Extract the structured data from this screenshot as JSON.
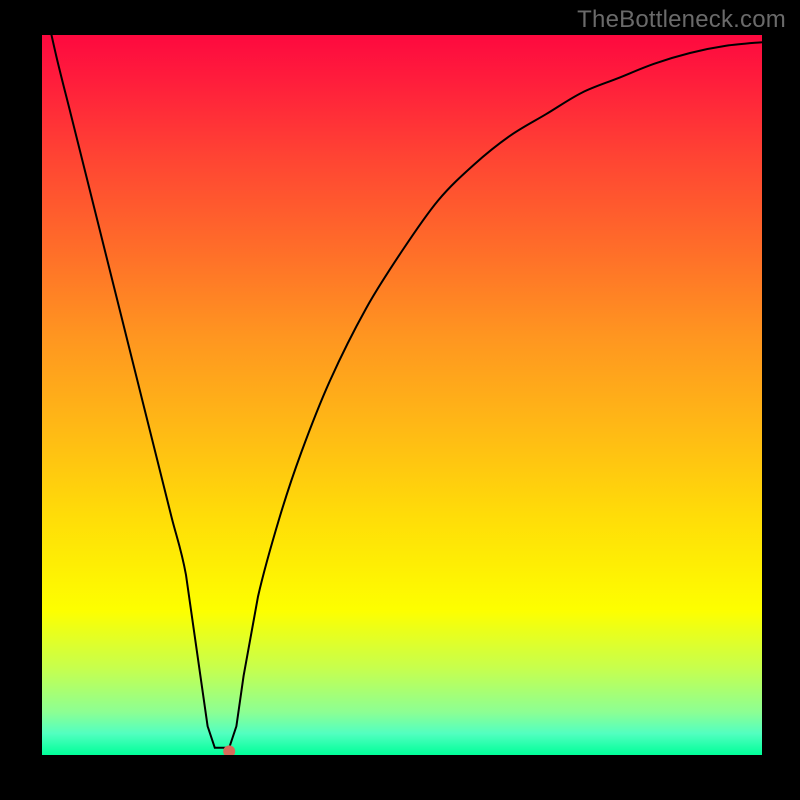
{
  "watermark": "TheBottleneck.com",
  "chart_data": {
    "type": "line",
    "title": "",
    "xlabel": "",
    "ylabel": "",
    "xlim": [
      0,
      100
    ],
    "ylim": [
      0,
      100
    ],
    "grid": false,
    "legend": false,
    "x": [
      0,
      2,
      4,
      6,
      8,
      10,
      12,
      14,
      16,
      18,
      20,
      22,
      23,
      24,
      25,
      26,
      27,
      28,
      30,
      33,
      36,
      40,
      45,
      50,
      55,
      60,
      65,
      70,
      75,
      80,
      85,
      90,
      95,
      100
    ],
    "y": [
      106,
      97,
      89,
      81,
      73,
      65,
      57,
      49,
      41,
      33,
      25,
      11,
      4,
      1,
      1,
      1,
      4,
      11,
      22,
      33,
      42,
      52,
      62,
      70,
      77,
      82,
      86,
      89,
      92,
      94,
      96,
      97.5,
      98.5,
      99
    ],
    "notch_start_x": 22,
    "notch_end_x": 28,
    "marker": {
      "x": 26,
      "y": 0.5,
      "color": "#d66b5a"
    },
    "background_gradient": {
      "direction": "top-to-bottom",
      "stops": [
        {
          "pos": 0,
          "color": "#fe093f"
        },
        {
          "pos": 0.17,
          "color": "#ff4433"
        },
        {
          "pos": 0.42,
          "color": "#ff9620"
        },
        {
          "pos": 0.67,
          "color": "#ffdd08"
        },
        {
          "pos": 0.8,
          "color": "#fdff00"
        },
        {
          "pos": 0.94,
          "color": "#8dff93"
        },
        {
          "pos": 1.0,
          "color": "#00ff99"
        }
      ]
    }
  }
}
